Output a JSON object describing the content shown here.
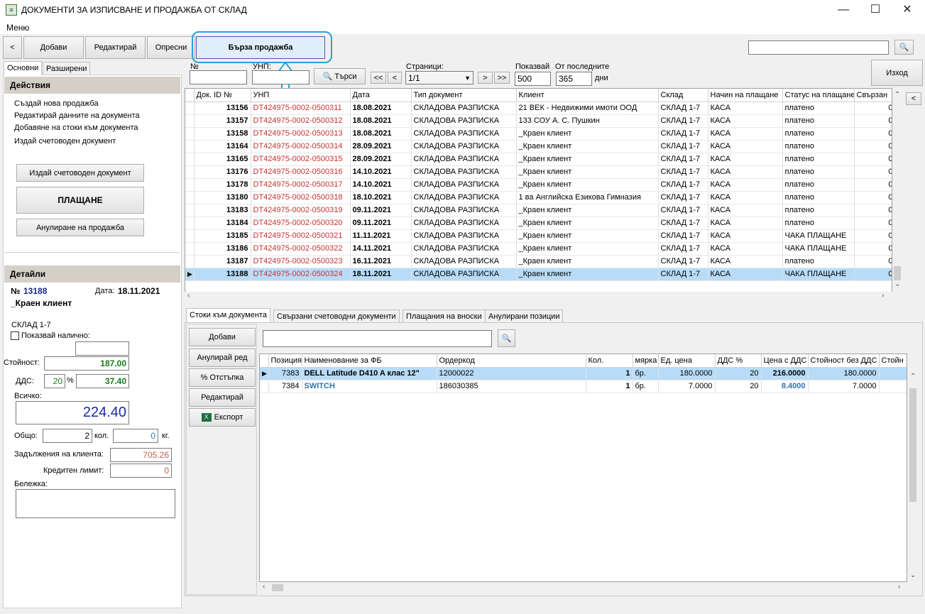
{
  "window": {
    "title": "ДОКУМЕНТИ ЗА ИЗПИСВАНЕ И ПРОДАЖБА ОТ СКЛАД",
    "min": "—",
    "max": "☐",
    "close": "✕"
  },
  "menu": {
    "label": "Меню"
  },
  "toolbar": {
    "back": "<",
    "add": "Добави",
    "edit": "Редактирай",
    "refresh": "Опресни",
    "quick_sale": "Бърза продажба"
  },
  "search": {
    "value": "",
    "icon": "search-icon"
  },
  "left_tabs": {
    "basic": "Основни",
    "extended": "Разширени"
  },
  "actions": {
    "title": "Действия",
    "items": [
      "Създай нова продажба",
      "Редактирай данните на документа",
      "Добавяне на стоки към документа",
      "Издай счетоводен документ"
    ],
    "issue_btn": "Издай счетоводен документ",
    "pay_btn": "ПЛАЩАНЕ",
    "cancel_btn": "Анулиране на продажба"
  },
  "details": {
    "title": "Детайли",
    "no_label": "№",
    "no": "13188",
    "date_label": "Дата:",
    "date": "18.11.2021",
    "client": "_Краен клиент",
    "warehouse": "СКЛАД 1-7",
    "show_avail": "Показвай налично:",
    "value_label": "Стойност:",
    "value": "187.00",
    "vat_label": "ДДС:",
    "vat_pct": "20",
    "pct": "%",
    "vat": "37.40",
    "total_label": "Всичко:",
    "total": "224.40",
    "general_label": "Общо:",
    "qty": "2",
    "qty_unit": "кол.",
    "kg": "0",
    "kg_unit": "кг.",
    "debt_label": "Задължения на клиента:",
    "debt": "705.26",
    "credit_label": "Кредитен лимит:",
    "credit": "0",
    "note_label": "Бележка:"
  },
  "filters": {
    "no_label": "№",
    "unp_label": "УНП:",
    "search_btn": "Търси",
    "first": "<<",
    "prev": "<",
    "pages_label": "Страници:",
    "page": "1/1",
    "next": ">",
    "last": ">>",
    "show_label": "Показвай",
    "show": "500",
    "last_label": "От последните",
    "days": "365",
    "days_unit": "дни",
    "exit": "Изход"
  },
  "docs": {
    "columns": [
      "Док. ID №",
      "УНП",
      "Дата",
      "Тип документ",
      "Клиент",
      "Склад",
      "Начин на плащане",
      "Статус на плащане",
      "Свързан"
    ],
    "rows": [
      [
        "13156",
        "DT424975-0002-0500311",
        "18.08.2021",
        "СКЛАДОВА РАЗПИСКА",
        "21 ВЕК - Недвижими имоти ООД",
        "СКЛАД 1-7",
        "КАСА",
        "платено",
        "0"
      ],
      [
        "13157",
        "DT424975-0002-0500312",
        "18.08.2021",
        "СКЛАДОВА РАЗПИСКА",
        "133 СОУ А. С. Пушкин",
        "СКЛАД 1-7",
        "КАСА",
        "платено",
        "0"
      ],
      [
        "13158",
        "DT424975-0002-0500313",
        "18.08.2021",
        "СКЛАДОВА РАЗПИСКА",
        "_Краен клиент",
        "СКЛАД 1-7",
        "КАСА",
        "платено",
        "0"
      ],
      [
        "13164",
        "DT424975-0002-0500314",
        "28.09.2021",
        "СКЛАДОВА РАЗПИСКА",
        "_Краен клиент",
        "СКЛАД 1-7",
        "КАСА",
        "платено",
        "0"
      ],
      [
        "13165",
        "DT424975-0002-0500315",
        "28.09.2021",
        "СКЛАДОВА РАЗПИСКА",
        "_Краен клиент",
        "СКЛАД 1-7",
        "КАСА",
        "платено",
        "0"
      ],
      [
        "13176",
        "DT424975-0002-0500316",
        "14.10.2021",
        "СКЛАДОВА РАЗПИСКА",
        "_Краен клиент",
        "СКЛАД 1-7",
        "КАСА",
        "платено",
        "0"
      ],
      [
        "13178",
        "DT424975-0002-0500317",
        "14.10.2021",
        "СКЛАДОВА РАЗПИСКА",
        "_Краен клиент",
        "СКЛАД 1-7",
        "КАСА",
        "платено",
        "0"
      ],
      [
        "13180",
        "DT424975-0002-0500318",
        "18.10.2021",
        "СКЛАДОВА РАЗПИСКА",
        "1 ва Английска Езикова Гимназия",
        "СКЛАД 1-7",
        "КАСА",
        "платено",
        "0"
      ],
      [
        "13183",
        "DT424975-0002-0500319",
        "09.11.2021",
        "СКЛАДОВА РАЗПИСКА",
        "_Краен клиент",
        "СКЛАД 1-7",
        "КАСА",
        "платено",
        "0"
      ],
      [
        "13184",
        "DT424975-0002-0500320",
        "09.11.2021",
        "СКЛАДОВА РАЗПИСКА",
        "_Краен клиент",
        "СКЛАД 1-7",
        "КАСА",
        "платено",
        "0"
      ],
      [
        "13185",
        "DT424975-0002-0500321",
        "11.11.2021",
        "СКЛАДОВА РАЗПИСКА",
        "_Краен клиент",
        "СКЛАД 1-7",
        "КАСА",
        "ЧАКА ПЛАЩАНЕ",
        "0"
      ],
      [
        "13186",
        "DT424975-0002-0500322",
        "14.11.2021",
        "СКЛАДОВА РАЗПИСКА",
        "_Краен клиент",
        "СКЛАД 1-7",
        "КАСА",
        "ЧАКА ПЛАЩАНЕ",
        "0"
      ],
      [
        "13187",
        "DT424975-0002-0500323",
        "16.11.2021",
        "СКЛАДОВА РАЗПИСКА",
        "_Краен клиент",
        "СКЛАД 1-7",
        "КАСА",
        "платено",
        "0"
      ],
      [
        "13188",
        "DT424975-0002-0500324",
        "18.11.2021",
        "СКЛАДОВА РАЗПИСКА",
        "_Краен клиент",
        "СКЛАД 1-7",
        "КАСА",
        "ЧАКА ПЛАЩАНЕ",
        "0"
      ]
    ]
  },
  "bottom_tabs": [
    "Стоки към документа",
    "Свързани счетоводни документи",
    "Плащания на вноски",
    "Анулирани позиции"
  ],
  "side_buttons": {
    "add": "Добави",
    "cancel_row": "Анулирай ред",
    "discount": "% Отстъпка",
    "edit": "Редактирай",
    "export": "Експорт"
  },
  "items": {
    "columns": [
      "Позиция",
      "Наименование за ФБ",
      "Ордеркод",
      "Кол.",
      "мярка",
      "Ед. цена",
      "ДДС %",
      "Цена с ДДС",
      "Стойност без ДДС",
      "Стойн"
    ],
    "rows": [
      [
        "7383",
        "DELL Latitude D410 A клас 12\"",
        "12000022",
        "1",
        "бр.",
        "180.0000",
        "20",
        "216.0000",
        "180.0000",
        ""
      ],
      [
        "7384",
        "SWITCH",
        "186030385",
        "1",
        "бр.",
        "7.0000",
        "20",
        "8.4000",
        "7.0000",
        ""
      ]
    ]
  },
  "colors": {
    "accent": "#2b9fd9",
    "selected": "#b8dcf8",
    "red": "#c83232",
    "green": "#1a7a1a",
    "blue": "#2e75b6"
  }
}
